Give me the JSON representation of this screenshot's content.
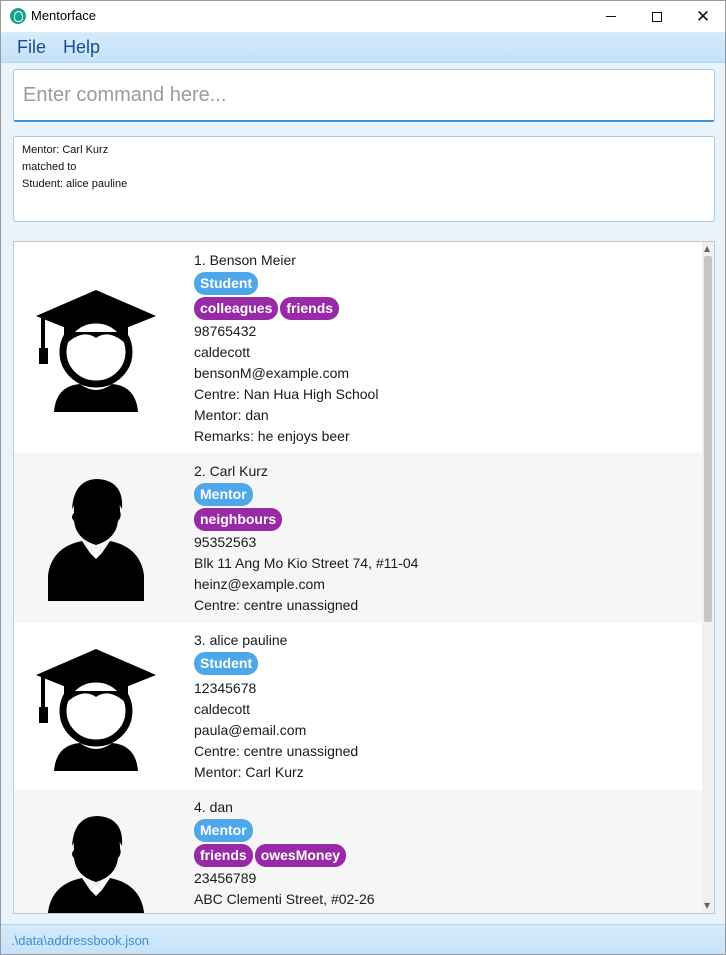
{
  "window": {
    "title": "Mentorface"
  },
  "menu": {
    "file": "File",
    "help": "Help"
  },
  "command": {
    "placeholder": "Enter command here...",
    "value": ""
  },
  "result": {
    "lines": [
      "Mentor: Carl Kurz",
      "matched to",
      "Student: alice pauline"
    ]
  },
  "colors": {
    "role_tag": "#4ea7e8",
    "other_tag": "#992aa7",
    "accent": "#3b93d6",
    "menubar": "#cfe6fa"
  },
  "persons": [
    {
      "name": "1.  Benson Meier",
      "role": "Student",
      "avatar_icon": "graduate-icon",
      "tags": [
        "colleagues",
        "friends"
      ],
      "details": [
        "98765432",
        "caldecott",
        "bensonM@example.com",
        "Centre: Nan Hua High School",
        "Mentor: dan",
        "Remarks: he enjoys beer"
      ]
    },
    {
      "name": "2.  Carl Kurz",
      "role": "Mentor",
      "avatar_icon": "mentor-person-icon",
      "tags": [
        "neighbours"
      ],
      "details": [
        "95352563",
        "Blk 11 Ang Mo Kio Street 74, #11-04",
        "heinz@example.com",
        "Centre: centre unassigned"
      ]
    },
    {
      "name": "3.  alice pauline",
      "role": "Student",
      "avatar_icon": "graduate-icon",
      "tags": [],
      "details": [
        "12345678",
        "caldecott",
        "paula@email.com",
        "Centre: centre unassigned",
        "Mentor: Carl Kurz"
      ]
    },
    {
      "name": "4.  dan",
      "role": "Mentor",
      "avatar_icon": "mentor-person-icon",
      "tags": [
        "friends",
        "owesMoney"
      ],
      "details": [
        "23456789",
        "ABC Clementi Street, #02-26"
      ]
    }
  ],
  "status": {
    "file_path": ".\\data\\addressbook.json"
  }
}
